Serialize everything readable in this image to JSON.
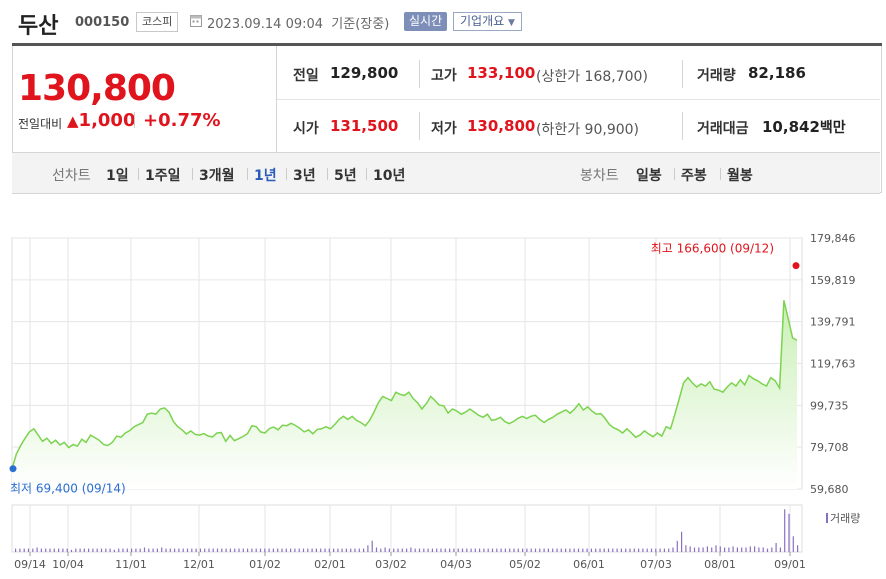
{
  "header": {
    "name": "두산",
    "code": "000150",
    "market": "코스피",
    "date": "2023.09.14 09:04  기준(장중)",
    "realtime": "실시간",
    "company_info": "기업개요"
  },
  "price": {
    "current": "130,800",
    "change_label": "전일대비",
    "change": "1,000",
    "change_pct": "+0.77%"
  },
  "stats": {
    "prev_label": "전일",
    "prev": "129,800",
    "high_label": "고가",
    "high": "133,100",
    "upper_limit": "(상한가 168,700)",
    "volume_label": "거래량",
    "volume": "82,186",
    "open_label": "시가",
    "open": "131,500",
    "low_label": "저가",
    "low": "130,800",
    "lower_limit": "(하한가 90,900)",
    "value_label": "거래대금",
    "value": "10,842",
    "value_unit": "백만"
  },
  "period": {
    "line_label": "선차트",
    "line_options": [
      "1일",
      "1주일",
      "3개월",
      "1년",
      "3년",
      "5년",
      "10년"
    ],
    "selected": "1년",
    "candle_label": "봉차트",
    "candle_options": [
      "일봉",
      "주봉",
      "월봉"
    ]
  },
  "chart_data": {
    "type": "area",
    "y_ticks": [
      "179,846",
      "159,819",
      "139,791",
      "119,763",
      "99,735",
      "79,708",
      "59,680"
    ],
    "ylim": [
      59680,
      179846
    ],
    "x_ticks": [
      "09/14",
      "10/04",
      "11/01",
      "12/01",
      "01/02",
      "02/01",
      "03/02",
      "04/03",
      "05/02",
      "06/01",
      "07/03",
      "08/01",
      "09/01"
    ],
    "high_note": "최고 166,600 (09/12)",
    "low_note": "최저 69,400 (09/14)",
    "volume_legend": "거래량",
    "colors": {
      "line": "#7bd34f",
      "fill_top": "#c9efb5",
      "fill_bottom": "#ffffff",
      "volume": "#8a70c2",
      "high": "#e0141d",
      "low": "#2a6fd1"
    },
    "series": [
      {
        "values": [
          69400,
          76500,
          80500,
          84000,
          87000,
          88500,
          85500,
          82500,
          84000,
          81500,
          83000,
          80800,
          82000,
          79500,
          81000,
          80200,
          83500,
          82000,
          85500,
          84300,
          83000,
          81000,
          80500,
          82000,
          85000,
          84500,
          86500,
          87700,
          89500,
          90500,
          91500,
          95500,
          96000,
          95500,
          98000,
          98500,
          96500,
          92000,
          89500,
          88000,
          86000,
          87500,
          85800,
          85500,
          86200,
          85000,
          84600,
          86500,
          86700,
          82500,
          85300,
          82800,
          83800,
          84800,
          86200,
          90000,
          89500,
          87000,
          86500,
          88600,
          89300,
          88000,
          90200,
          90000,
          91200,
          90100,
          88800,
          87000,
          88000,
          86100,
          88200,
          88500,
          89500,
          88500,
          90500,
          93000,
          94500,
          93000,
          94500,
          92500,
          91500,
          90000,
          92500,
          96500,
          101000,
          104000,
          103000,
          102000,
          106000,
          105000,
          104500,
          106000,
          103000,
          101000,
          98000,
          100500,
          104000,
          102000,
          99800,
          99500,
          96000,
          98000,
          97000,
          95500,
          96500,
          98000,
          96500,
          95000,
          94000,
          95500,
          92500,
          93000,
          94000,
          92000,
          91000,
          92000,
          93500,
          94500,
          93500,
          94500,
          95000,
          93000,
          91500,
          93000,
          94000,
          95500,
          96500,
          97500,
          96000,
          98000,
          100500,
          97500,
          99000,
          97000,
          95500,
          95800,
          93500,
          90500,
          89000,
          88000,
          86500,
          88500,
          86600,
          84500,
          85500,
          87500,
          86000,
          84700,
          86500,
          85000,
          89500,
          88500,
          95500,
          103000,
          110500,
          113000,
          110500,
          108500,
          110000,
          109000,
          111000,
          107500,
          107000,
          106000,
          108500,
          110500,
          109000,
          112000,
          109500,
          114000,
          112500,
          111500,
          110000,
          109000,
          113000,
          111500,
          108000,
          150000,
          141000,
          132000,
          130800
        ]
      }
    ],
    "volume": [
      3,
      3,
      3,
      3,
      3,
      4,
      3,
      3,
      3,
      3,
      3,
      3,
      3,
      2,
      3,
      3,
      3,
      3,
      3,
      3,
      3,
      3,
      3,
      2,
      3,
      3,
      3,
      3,
      3,
      3,
      4,
      3,
      3,
      3,
      4,
      3,
      3,
      3,
      3,
      3,
      3,
      3,
      3,
      3,
      3,
      3,
      3,
      3,
      3,
      3,
      3,
      3,
      3,
      3,
      3,
      3,
      3,
      3,
      3,
      3,
      3,
      3,
      3,
      3,
      3,
      3,
      3,
      3,
      3,
      3,
      3,
      3,
      3,
      3,
      3,
      3,
      3,
      3,
      3,
      3,
      3,
      3,
      6,
      10,
      4,
      3,
      4,
      3,
      3,
      3,
      3,
      3,
      4,
      3,
      3,
      3,
      3,
      3,
      3,
      3,
      3,
      3,
      3,
      3,
      3,
      3,
      3,
      3,
      3,
      3,
      3,
      3,
      3,
      3,
      3,
      3,
      3,
      3,
      3,
      3,
      3,
      3,
      3,
      3,
      3,
      3,
      3,
      3,
      3,
      3,
      3,
      3,
      3,
      3,
      3,
      3,
      3,
      3,
      3,
      3,
      3,
      3,
      3,
      3,
      3,
      3,
      3,
      3,
      3,
      3,
      3,
      3,
      3,
      4,
      10,
      18,
      6,
      5,
      4,
      4,
      4,
      5,
      4,
      6,
      5,
      4,
      4,
      5,
      4,
      4,
      4,
      5,
      5,
      4,
      4,
      3,
      4,
      8,
      4,
      38,
      34,
      14,
      6
    ]
  }
}
